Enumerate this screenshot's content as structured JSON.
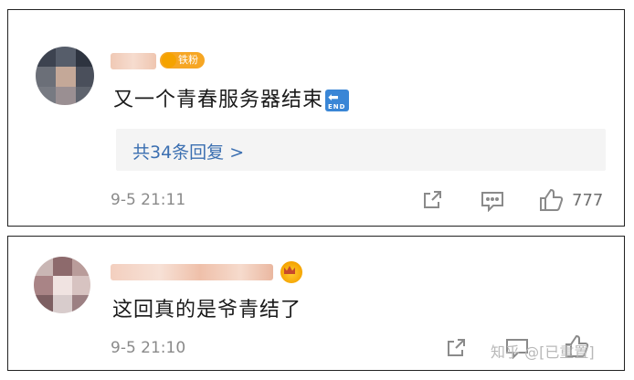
{
  "card1": {
    "comment_text": "又一个青春服务器结束",
    "end_icon_text": "END",
    "fan_badge": "铁粉",
    "replies_link": "共34条回复 >",
    "timestamp": "9-5 21:11",
    "like_count": "777"
  },
  "card2": {
    "comment_text": "这回真的是爷青结了",
    "timestamp": "9-5 21:10"
  },
  "watermark": "知乎 @[已重置]",
  "colors": {
    "link_blue": "#3b6fb1",
    "meta_gray": "#8a8a8a",
    "badge_orange": "#f6a623",
    "end_icon_blue": "#3a86d6"
  },
  "icons": [
    "share-icon",
    "comment-icon",
    "like-icon",
    "crown-icon",
    "end-icon"
  ]
}
